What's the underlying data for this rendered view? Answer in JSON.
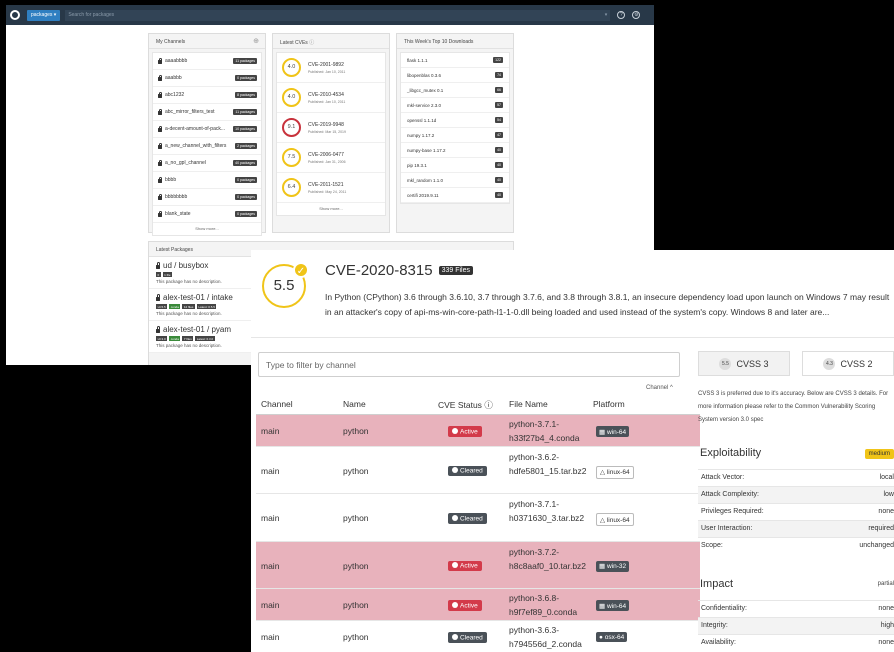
{
  "topbar": {
    "packages_button": "packages",
    "search_placeholder": "Search for packages"
  },
  "my_channels": {
    "title": "My Channels",
    "items": [
      {
        "name": "aaaabbbb",
        "badge": "11 packages"
      },
      {
        "name": "aaabbb",
        "badge": "0 packages"
      },
      {
        "name": "abc1232",
        "badge": "8 packages"
      },
      {
        "name": "abc_mirror_filters_test",
        "badge": "11 packages"
      },
      {
        "name": "a-decent-amount-of-pack...",
        "badge": "10 packages"
      },
      {
        "name": "a_new_channel_with_filters",
        "badge": "2 packages"
      },
      {
        "name": "a_no_gpl_channel",
        "badge": "40 packages"
      },
      {
        "name": "bbbb",
        "badge": "0 packages"
      },
      {
        "name": "bbbbbbbb",
        "badge": "0 packages"
      },
      {
        "name": "blank_state",
        "badge": "0 packages"
      }
    ],
    "show_more": "Show more..."
  },
  "latest_cves": {
    "title": "Latest CVEs",
    "items": [
      {
        "score": "4.0",
        "id": "CVE-2001-9892",
        "published": "Published: Jan 10, 2011",
        "color": "#f0c418"
      },
      {
        "score": "4.0",
        "id": "CVE-2010-4534",
        "published": "Published: Jan 10, 2011",
        "color": "#f0c418"
      },
      {
        "score": "9.1",
        "id": "CVE-2019-9948",
        "published": "Published: Mar 15, 2019",
        "color": "#c8323c"
      },
      {
        "score": "7.5",
        "id": "CVE-2006-0477",
        "published": "Published: Jan 31, 2006",
        "color": "#f0c418"
      },
      {
        "score": "6.4",
        "id": "CVE-2011-1521",
        "published": "Published: May 24, 2011",
        "color": "#f0c418"
      }
    ],
    "show_more": "Show more..."
  },
  "top_downloads": {
    "title": "This Week's Top 10 Downloads",
    "items": [
      {
        "name": "flask 1.1.1",
        "count": "122"
      },
      {
        "name": "libopenblas 0.3.6",
        "count": "74"
      },
      {
        "name": "_libgcc_mutex 0.1",
        "count": "66"
      },
      {
        "name": "mkl-service 2.3.0",
        "count": "57"
      },
      {
        "name": "openssl 1.1.1d",
        "count": "54"
      },
      {
        "name": "numpy 1.17.2",
        "count": "47"
      },
      {
        "name": "numpy-base 1.17.2",
        "count": "40"
      },
      {
        "name": "pip 19.3.1",
        "count": "40"
      },
      {
        "name": "mkl_random 1.1.0",
        "count": "40"
      },
      {
        "name": "certifi 2019.9.11",
        "count": "40"
      }
    ]
  },
  "latest_packages": {
    "title": "Latest Packages",
    "items": [
      {
        "name": "ud / busybox",
        "badges": [
          "0",
          "1 file"
        ],
        "desc": "This package has no description."
      },
      {
        "name": "alex-test-01 / intake",
        "badges": [
          "v0.5.5",
          "conda",
          "12 files",
          "Latest: 0.5.5"
        ],
        "desc": "This package has no description."
      },
      {
        "name": "alex-test-01 / pyam",
        "badges": [
          "v0.3.0",
          "conda",
          "7 files",
          "Latest: 0.3.0"
        ],
        "desc": "This package has no description."
      }
    ]
  },
  "cve": {
    "score": "5.5",
    "score_color": "#f0c418",
    "id": "CVE-2020-8315",
    "files_badge": "339 Files",
    "description": "In Python (CPython) 3.6 through 3.6.10, 3.7 through 3.7.6, and 3.8 through 3.8.1, an insecure dependency load upon launch on Windows 7 may result in an attacker's copy of api-ms-win-core-path-l1-1-0.dll being loaded and used instead of the system's copy. Windows 8 and later are..."
  },
  "filter_placeholder": "Type to filter by channel",
  "channel_sort_label": "Channel ^",
  "table": {
    "headers": [
      "Channel",
      "Name",
      "CVE Status",
      "File Name",
      "Platform"
    ],
    "rows": [
      {
        "channel": "main",
        "name": "python",
        "status": "Active",
        "file": "python-3.7.1-h33f27b4_4.conda",
        "platform": "win-64"
      },
      {
        "channel": "main",
        "name": "python",
        "status": "Cleared",
        "file": "python-3.6.2-hdfe5801_15.tar.bz2",
        "platform": "linux-64"
      },
      {
        "channel": "main",
        "name": "python",
        "status": "Cleared",
        "file": "python-3.7.1-h0371630_3.tar.bz2",
        "platform": "linux-64"
      },
      {
        "channel": "main",
        "name": "python",
        "status": "Active",
        "file": "python-3.7.2-h8c8aaf0_10.tar.bz2",
        "platform": "win-32"
      },
      {
        "channel": "main",
        "name": "python",
        "status": "Active",
        "file": "python-3.6.8-h9f7ef89_0.conda",
        "platform": "win-64"
      },
      {
        "channel": "main",
        "name": "python",
        "status": "Cleared",
        "file": "python-3.6.3-h794556d_2.conda",
        "platform": "osx-64"
      }
    ]
  },
  "cvss": {
    "tab_v3_score": "5.5",
    "tab_v3_label": "CVSS 3",
    "tab_v2_score": "4.3",
    "tab_v2_label": "CVSS 2",
    "note": "CVSS 3 is preferred due to it's accuracy. Below are CVSS 3 details. For more information please refer to the Common Vulnerability Scoring System version 3.0 spec",
    "exploitability_title": "Exploitability",
    "exploitability_level": "medium",
    "exploitability": [
      {
        "label": "Attack Vector:",
        "value": "local"
      },
      {
        "label": "Attack Complexity:",
        "value": "low"
      },
      {
        "label": "Privileges Required:",
        "value": "none"
      },
      {
        "label": "User Interaction:",
        "value": "required"
      },
      {
        "label": "Scope:",
        "value": "unchanged"
      }
    ],
    "impact_title": "Impact",
    "impact_level": "partial",
    "impact": [
      {
        "label": "Confidentiality:",
        "value": "none"
      },
      {
        "label": "Integrity:",
        "value": "high"
      },
      {
        "label": "Availability:",
        "value": "none"
      }
    ]
  }
}
